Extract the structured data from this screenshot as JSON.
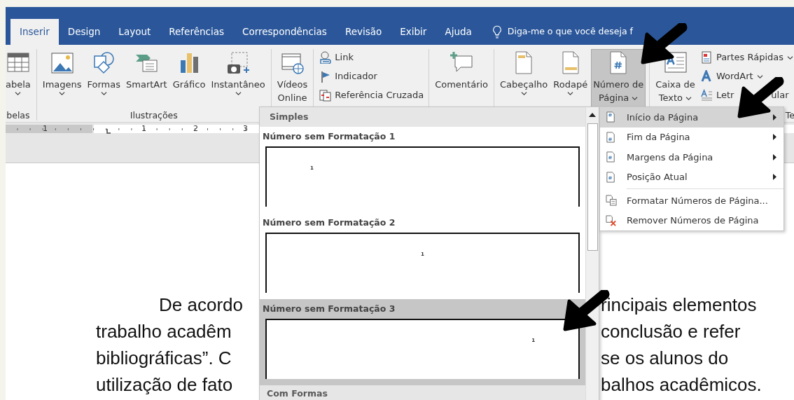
{
  "tabs": [
    {
      "label": "Inserir",
      "selected": true
    },
    {
      "label": "Design",
      "selected": false
    },
    {
      "label": "Layout",
      "selected": false
    },
    {
      "label": "Referências",
      "selected": false
    },
    {
      "label": "Correspondências",
      "selected": false
    },
    {
      "label": "Revisão",
      "selected": false
    },
    {
      "label": "Exibir",
      "selected": false
    },
    {
      "label": "Ajuda",
      "selected": false
    }
  ],
  "tell_me": "Diga-me o que você deseja f",
  "ribbon": {
    "groups": [
      {
        "label": "belas",
        "buttons": [
          {
            "kind": "large",
            "lines": [
              "abela"
            ],
            "dropdown": true,
            "selected": false
          }
        ]
      },
      {
        "label": "Ilustrações",
        "buttons": [
          {
            "kind": "large",
            "lines": [
              "Imagens"
            ],
            "dropdown": true,
            "selected": false
          },
          {
            "kind": "large",
            "lines": [
              "Formas"
            ],
            "dropdown": true,
            "selected": false
          },
          {
            "kind": "large",
            "lines": [
              "SmartArt"
            ],
            "dropdown": false,
            "selected": false
          },
          {
            "kind": "large",
            "lines": [
              "Gráfico"
            ],
            "dropdown": false,
            "selected": false
          },
          {
            "kind": "large",
            "lines": [
              "Instantâneo"
            ],
            "dropdown": true,
            "selected": false
          }
        ]
      },
      {
        "buttons": [
          {
            "kind": "large",
            "lines": [
              "Vídeos",
              "Online"
            ],
            "dropdown": false,
            "selected": false
          }
        ]
      },
      {
        "buttons": [
          {
            "kind": "small",
            "lines": [
              "Link"
            ],
            "dropdown": false,
            "selected": false
          },
          {
            "kind": "small",
            "lines": [
              "Indicador"
            ],
            "dropdown": false,
            "selected": false
          },
          {
            "kind": "small",
            "lines": [
              "Referência Cruzada"
            ],
            "dropdown": false,
            "selected": false
          }
        ]
      },
      {
        "buttons": [
          {
            "kind": "large",
            "lines": [
              "Comentário"
            ],
            "dropdown": false,
            "selected": false
          }
        ]
      },
      {
        "buttons": [
          {
            "kind": "large",
            "lines": [
              "Cabeçalho"
            ],
            "dropdown": true,
            "selected": false
          },
          {
            "kind": "large",
            "lines": [
              "Rodapé"
            ],
            "dropdown": true,
            "selected": false
          },
          {
            "kind": "large",
            "lines": [
              "Número de",
              "Página"
            ],
            "dropdown": true,
            "selected": true
          }
        ]
      },
      {
        "label": "Te",
        "buttons": [
          {
            "kind": "large",
            "lines": [
              "Caixa de",
              "Texto"
            ],
            "dropdown": true,
            "selected": false
          },
          {
            "kind": "small",
            "lines": [
              "Partes Rápidas"
            ],
            "dropdown": true,
            "selected": false
          },
          {
            "kind": "small",
            "lines": [
              "WordArt"
            ],
            "dropdown": true,
            "selected": false
          },
          {
            "kind": "small",
            "lines": [
              "Letr",
              "ular"
            ],
            "dropdown": false,
            "selected": false
          }
        ]
      }
    ]
  },
  "ruler": {
    "numbers": [
      "1",
      "1",
      "2",
      "3"
    ]
  },
  "document": {
    "lines": [
      {
        "left": "De acordo",
        "right": "rincipais elementos",
        "indent": true
      },
      {
        "left": "trabalho acadêm",
        "right": "conclusão e refer",
        "indent": false
      },
      {
        "left": "bibliográficas”. C",
        "right": "se os alunos do",
        "indent": false
      },
      {
        "left": "utilização de fato",
        "right": "balhos acadêmicos.",
        "indent": false
      }
    ]
  },
  "gallery": {
    "header": "Simples",
    "items": [
      {
        "label": "Número sem Formatação 1",
        "number": "1",
        "kind": "left",
        "selected": false
      },
      {
        "label": "Número sem Formatação 2",
        "number": "1",
        "kind": "center",
        "selected": false
      },
      {
        "label": "Número sem Formatação 3",
        "number": "1",
        "kind": "right",
        "selected": true
      }
    ],
    "footer": "Com Formas"
  },
  "submenu": {
    "items": [
      {
        "kind": "submenu",
        "label": "Início da Página",
        "selected": true
      },
      {
        "kind": "submenu",
        "label": "Fim da Página",
        "selected": false
      },
      {
        "kind": "submenu",
        "label": "Margens da Página",
        "selected": false
      },
      {
        "kind": "submenu",
        "label": "Posição Atual",
        "selected": false
      },
      {
        "kind": "command",
        "label": "Formatar Números de Página...",
        "selected": false
      },
      {
        "kind": "command",
        "label": "Remover Números de Página",
        "selected": false
      }
    ]
  }
}
